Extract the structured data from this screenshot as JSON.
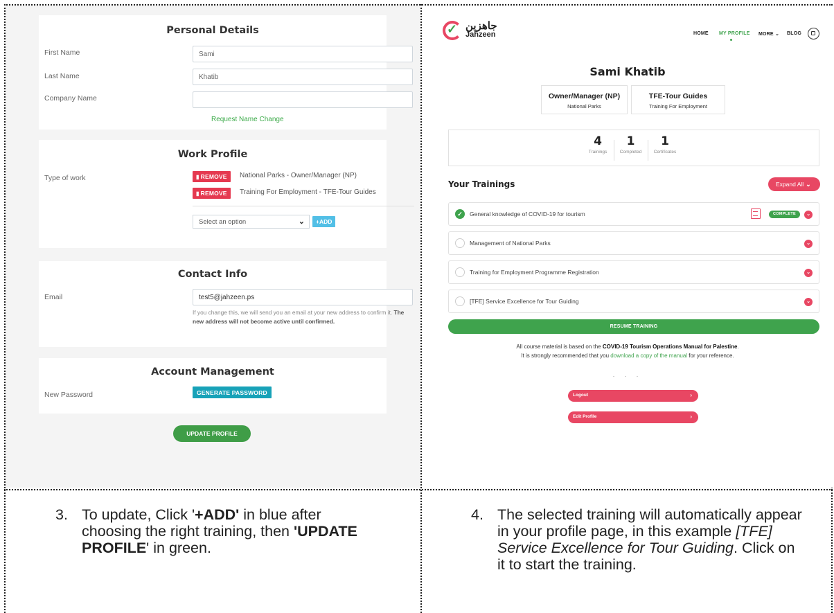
{
  "left": {
    "personal": {
      "title": "Personal Details",
      "first_name_label": "First Name",
      "first_name_value": "Sami",
      "last_name_label": "Last Name",
      "last_name_value": "Khatib",
      "company_label": "Company Name",
      "company_value": "",
      "request_change": "Request Name Change"
    },
    "work": {
      "title": "Work Profile",
      "type_label": "Type of work",
      "remove_label": "REMOVE",
      "items": [
        "National Parks - Owner/Manager (NP)",
        "Training For Employment - TFE-Tour Guides"
      ],
      "select_value": "Select an option",
      "add_label": "+ADD"
    },
    "contact": {
      "title": "Contact Info",
      "email_label": "Email",
      "email_value": "test5@jahzeen.ps",
      "note_plain": "If you change this, we will send you an email at your new address to confirm it.",
      "note_bold": "The new address will not become active until confirmed."
    },
    "account": {
      "title": "Account Management",
      "password_label": "New Password",
      "generate_label": "GENERATE PASSWORD"
    },
    "update_label": "UPDATE PROFILE"
  },
  "right": {
    "logo": {
      "arabic": "جاهزين",
      "english": "Jahzeen"
    },
    "nav": {
      "home": "HOME",
      "profile": "MY PROFILE",
      "more": "MORE",
      "blog": "BLOG"
    },
    "user_name": "Sami Khatib",
    "roles": [
      {
        "title": "Owner/Manager (NP)",
        "subtitle": "National Parks"
      },
      {
        "title": "TFE-Tour Guides",
        "subtitle": "Training For Employment"
      }
    ],
    "stats": [
      {
        "num": "4",
        "label": "Trainings"
      },
      {
        "num": "1",
        "label": "Completed"
      },
      {
        "num": "1",
        "label": "Certificates"
      }
    ],
    "your_trainings": "Your Trainings",
    "expand_all": "Expand All",
    "trainings": [
      {
        "title": "General knowledge of COVID-19 for tourism",
        "status": "COMPLETE"
      },
      {
        "title": "Management of National Parks"
      },
      {
        "title": "Training for Employment Programme Registration"
      },
      {
        "title": "[TFE] Service Excellence for Tour Guiding"
      }
    ],
    "resume_label": "RESUME TRAINING",
    "note1_a": "All course material is based on the",
    "note1_b": "COVID-19 Tourism Operations Manual for Palestine",
    "note2_a": "It is strongly recommended that you",
    "note2_link": "download a copy of the manual",
    "note2_b": "for your reference.",
    "dots": ". . .",
    "logout_label": "Logout",
    "edit_label": "Edit Profile"
  },
  "captions": {
    "step3": {
      "num": "3.",
      "t1": "To update, Click '",
      "b1": "+ADD'",
      "t2": " in blue after choosing the right training, then ",
      "b2": "'UPDATE PROFILE",
      "t3": "' in green."
    },
    "step4": {
      "num": "4.",
      "t1": "The selected training will automatically appear in your profile page, in this example ",
      "i1": "[TFE] Service Excellence for Tour Guiding",
      "t2": ". Click on it to start the training."
    }
  }
}
